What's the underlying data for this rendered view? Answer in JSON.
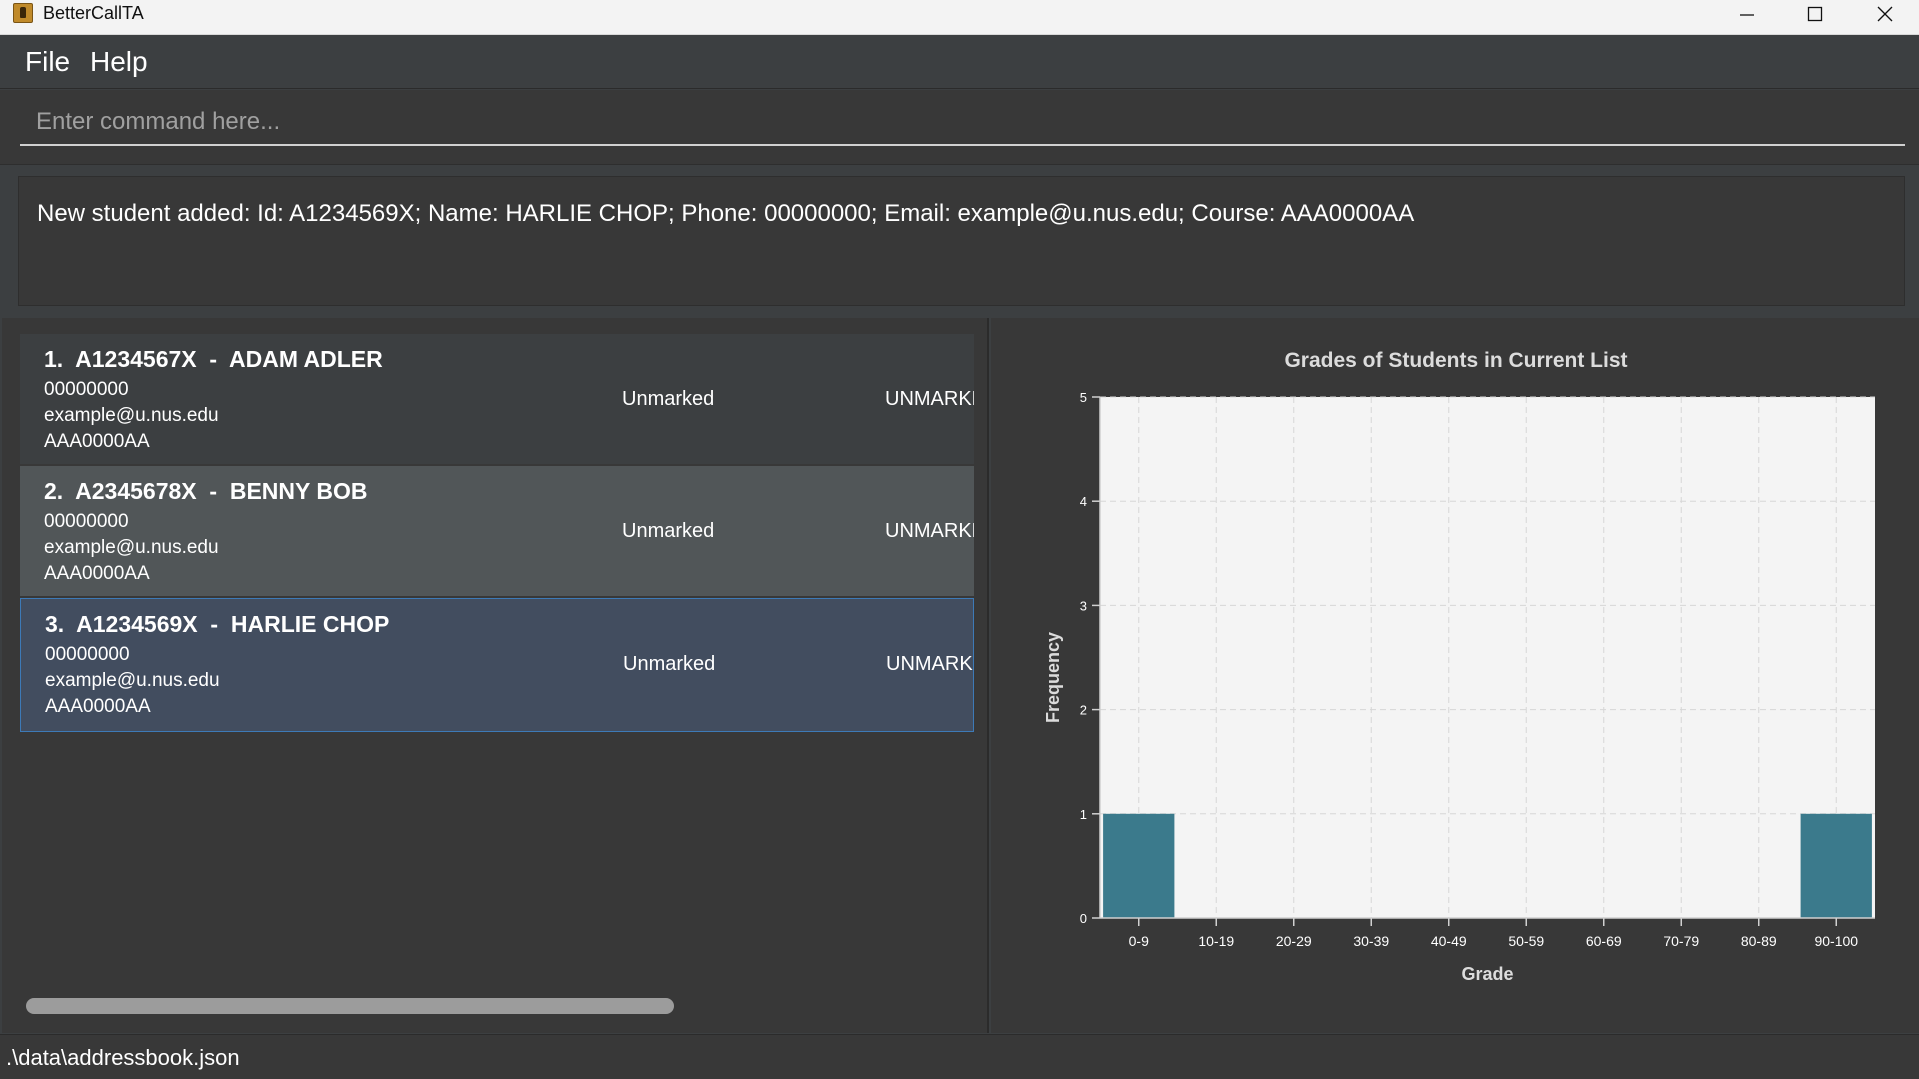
{
  "window": {
    "title": "BetterCallTA"
  },
  "menu": {
    "file": "File",
    "help": "Help"
  },
  "command": {
    "placeholder": "Enter command here...",
    "value": ""
  },
  "result": {
    "text": "New student added: Id: A1234569X; Name: HARLIE CHOP; Phone: 00000000; Email: example@u.nus.edu; Course: AAA0000AA"
  },
  "students": [
    {
      "index": "1.",
      "id": "A1234567X",
      "name": "ADAM ADLER",
      "phone": "00000000",
      "email": "example@u.nus.edu",
      "course": "AAA0000AA",
      "status": "Unmarked",
      "attendance": "UNMARKE"
    },
    {
      "index": "2.",
      "id": "A2345678X",
      "name": "BENNY BOB",
      "phone": "00000000",
      "email": "example@u.nus.edu",
      "course": "AAA0000AA",
      "status": "Unmarked",
      "attendance": "UNMARKE"
    },
    {
      "index": "3.",
      "id": "A1234569X",
      "name": "HARLIE CHOP",
      "phone": "00000000",
      "email": "example@u.nus.edu",
      "course": "AAA0000AA",
      "status": "Unmarked",
      "attendance": "UNMARKE"
    }
  ],
  "status_bar": {
    "path": ".\\data\\addressbook.json"
  },
  "chart_data": {
    "type": "bar",
    "title": "Grades of Students in Current List",
    "xlabel": "Grade",
    "ylabel": "Frequency",
    "categories": [
      "0-9",
      "10-19",
      "20-29",
      "30-39",
      "40-49",
      "50-59",
      "60-69",
      "70-79",
      "80-89",
      "90-100"
    ],
    "values": [
      1,
      0,
      0,
      0,
      0,
      0,
      0,
      0,
      0,
      1
    ],
    "ylim": [
      0,
      5
    ],
    "yticks": [
      0,
      1,
      2,
      3,
      4,
      5
    ],
    "grid": true,
    "bar_color": "#3b7a8c"
  }
}
